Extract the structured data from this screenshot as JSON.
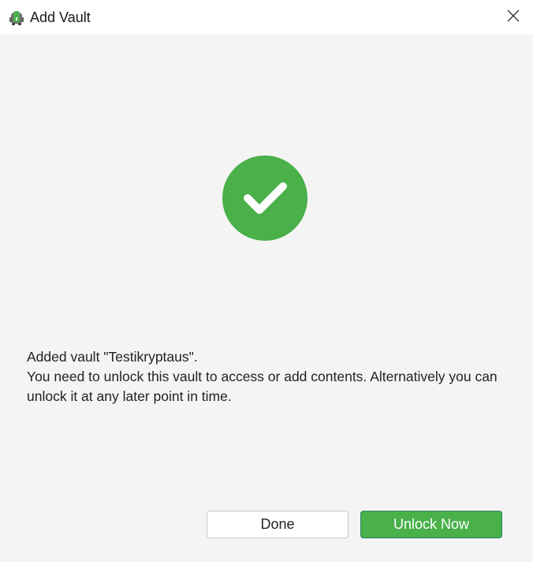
{
  "window": {
    "title": "Add Vault",
    "app_icon": "cryptomator-robot-icon",
    "close_icon": "close-icon"
  },
  "status": {
    "icon": "checkmark-icon",
    "color": "#49b04a"
  },
  "message": {
    "line1": "Added vault \"Testikryptaus\".",
    "line2": "You need to unlock this vault to access or add contents. Alternatively you can unlock it at any later point in time."
  },
  "buttons": {
    "done_label": "Done",
    "unlock_label": "Unlock Now"
  },
  "colors": {
    "accent": "#49b04a",
    "accent_border": "#2f7f63",
    "background": "#f4f4f4"
  }
}
